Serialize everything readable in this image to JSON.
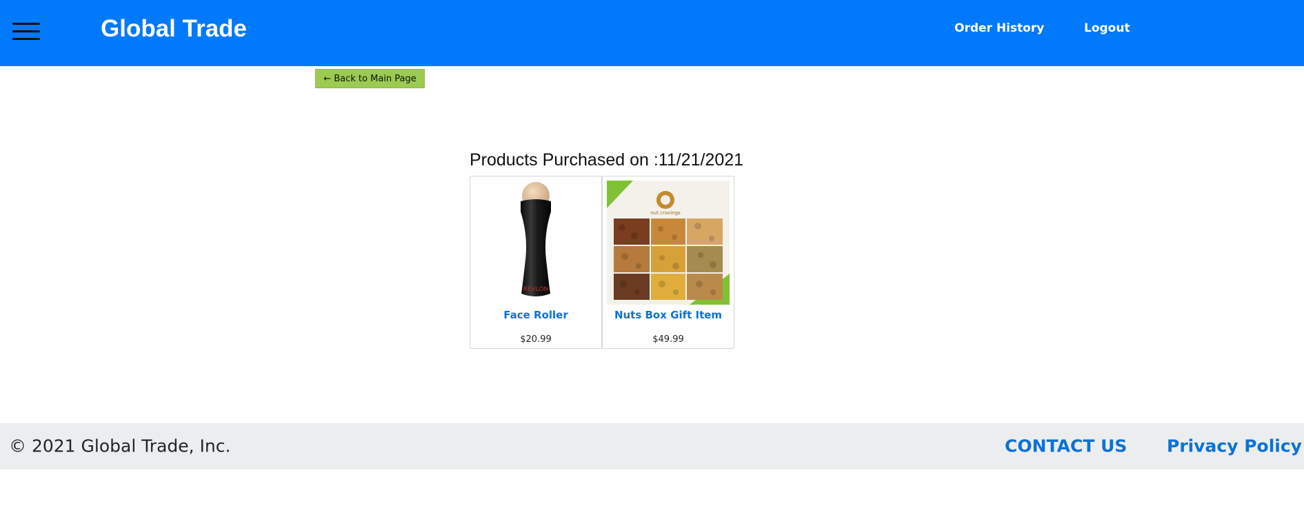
{
  "header": {
    "menu_icon": "hamburger-menu-icon",
    "brand": "Global Trade",
    "nav": {
      "order_history": "Order History",
      "logout": "Logout"
    },
    "background_color": "#0079fa"
  },
  "back_button": {
    "label": "← Back to Main Page",
    "color": "#9bcb51"
  },
  "purchase": {
    "title": "Products Purchased on :11/21/2021",
    "products": [
      {
        "name": "Face Roller",
        "price": "$20.99",
        "image": "face-roller-image"
      },
      {
        "name": "Nuts Box Gift Item",
        "price": "$49.99",
        "image": "nuts-gift-box-image"
      }
    ]
  },
  "footer": {
    "copyright": "© 2021 Global Trade, Inc.",
    "contact": "CONTACT US",
    "privacy": "Privacy Policy",
    "link_color": "#0b72d6"
  }
}
